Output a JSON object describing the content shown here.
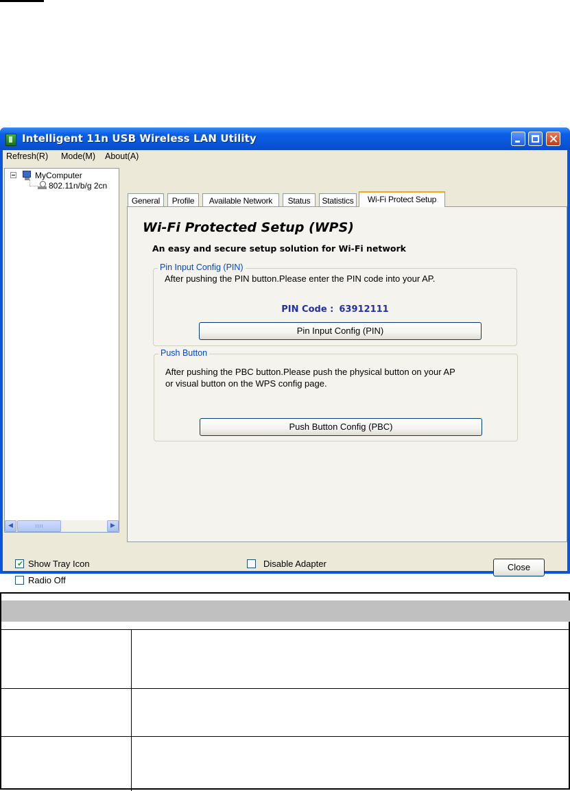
{
  "window": {
    "title": "Intelligent 11n USB Wireless LAN Utility"
  },
  "menu": [
    "Refresh(R)",
    "Mode(M)",
    "About(A)"
  ],
  "tree": {
    "root": "MyComputer",
    "child": "802.11n/b/g 2cn"
  },
  "tabs": [
    "General",
    "Profile",
    "Available Network",
    "Status",
    "Statistics",
    "Wi-Fi Protect Setup"
  ],
  "active_tab": "Wi-Fi Protect Setup",
  "wps": {
    "title": "Wi-Fi Protected Setup (WPS)",
    "subtitle": "An easy and secure setup solution for Wi-Fi network",
    "pin_group": {
      "legend": "Pin Input Config (PIN)",
      "description": "After pushing the PIN button.Please enter the PIN code into your AP.",
      "pin_label": "PIN Code :",
      "pin_value": "63912111",
      "button": "Pin Input Config (PIN)"
    },
    "pbc_group": {
      "legend": "Push Button",
      "description_line1": "After pushing the PBC button.Please push the physical button on your AP",
      "description_line2": "or visual button on the WPS config page.",
      "button": "Push Button Config (PBC)"
    }
  },
  "footer": {
    "show_tray_icon": "Show Tray Icon",
    "show_tray_icon_checked": true,
    "radio_off": "Radio Off",
    "radio_off_checked": false,
    "disable_adapter": "Disable Adapter",
    "disable_adapter_checked": false,
    "close": "Close"
  }
}
